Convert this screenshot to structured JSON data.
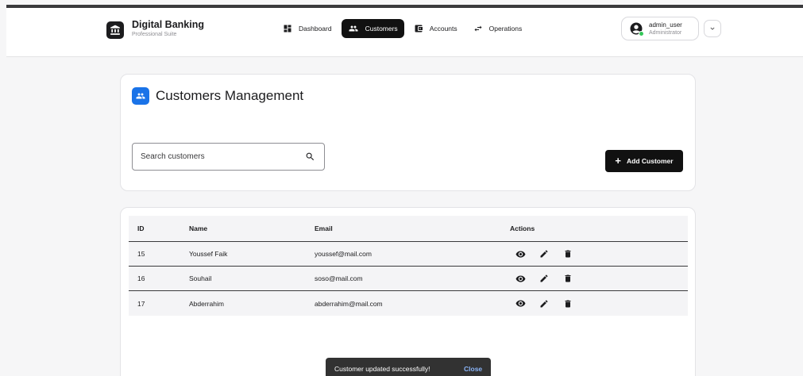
{
  "brand": {
    "title": "Digital Banking",
    "subtitle": "Professional Suite"
  },
  "nav": [
    {
      "label": "Dashboard",
      "icon": "dashboard-icon",
      "active": false
    },
    {
      "label": "Customers",
      "icon": "people-icon",
      "active": true
    },
    {
      "label": "Accounts",
      "icon": "wallet-icon",
      "active": false
    },
    {
      "label": "Operations",
      "icon": "swap-arrows-icon",
      "active": false
    }
  ],
  "user": {
    "name": "admin_user",
    "role": "Administrator",
    "status_color": "#34c759"
  },
  "page": {
    "title": "Customers Management",
    "accent": "#1a73e8"
  },
  "search": {
    "placeholder": "Search customers",
    "value": ""
  },
  "add_button": {
    "label": "Add Customer"
  },
  "table": {
    "headers": {
      "id": "ID",
      "name": "Name",
      "email": "Email",
      "actions": "Actions"
    },
    "rows": [
      {
        "id": "15",
        "name": "Youssef Faik",
        "email": "youssef@mail.com"
      },
      {
        "id": "16",
        "name": "Souhail",
        "email": "soso@mail.com"
      },
      {
        "id": "17",
        "name": "Abderrahim",
        "email": "abderrahim@mail.com"
      }
    ],
    "row_actions": [
      "eye-icon",
      "pencil-icon",
      "trash-icon"
    ]
  },
  "snackbar": {
    "message": "Customer updated successfully!",
    "action": "Close"
  }
}
